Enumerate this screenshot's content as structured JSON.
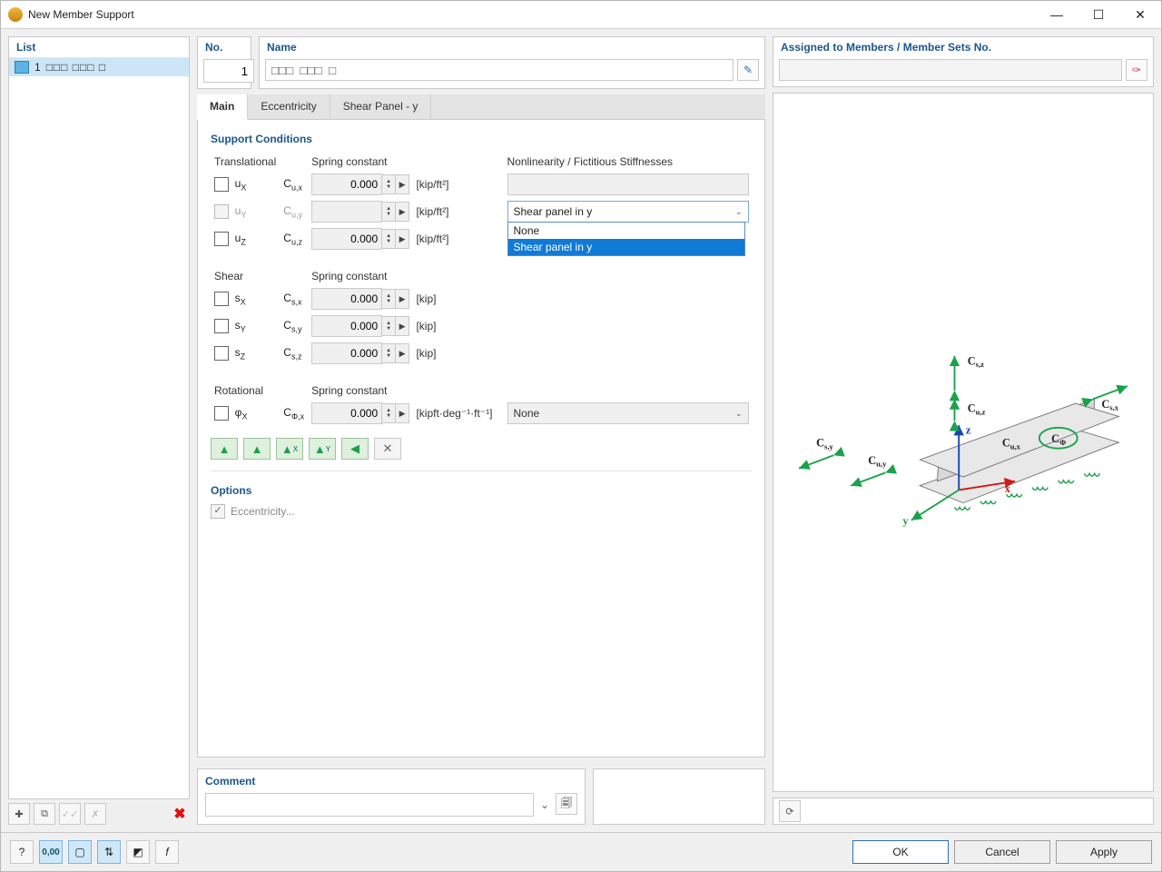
{
  "window": {
    "title": "New Member Support"
  },
  "left": {
    "header": "List",
    "row_index": "1",
    "row_text": "□□□  □□□  □"
  },
  "header": {
    "no_label": "No.",
    "no_value": "1",
    "name_label": "Name",
    "name_value": "□□□  □□□  □",
    "assigned_label": "Assigned to Members / Member Sets No."
  },
  "tabs": {
    "main": "Main",
    "ecc": "Eccentricity",
    "shear": "Shear Panel - y"
  },
  "support": {
    "title": "Support Conditions",
    "trans_label": "Translational",
    "spring_label": "Spring constant",
    "nonlin_label": "Nonlinearity / Fictitious Stiffnesses",
    "shear_label": "Shear",
    "rot_label": "Rotational",
    "rows": {
      "ux": {
        "sym": "u",
        "sub": "X",
        "k": "C",
        "ksub": "u,x",
        "val": "0.000",
        "unit": "[kip/ft²]"
      },
      "uy": {
        "sym": "u",
        "sub": "Y",
        "k": "C",
        "ksub": "u,y",
        "val": "",
        "unit": "[kip/ft²]"
      },
      "uz": {
        "sym": "u",
        "sub": "Z",
        "k": "C",
        "ksub": "u,z",
        "val": "0.000",
        "unit": "[kip/ft²]"
      },
      "sx": {
        "sym": "s",
        "sub": "X",
        "k": "C",
        "ksub": "s,x",
        "val": "0.000",
        "unit": "[kip]"
      },
      "sy": {
        "sym": "s",
        "sub": "Y",
        "k": "C",
        "ksub": "s,y",
        "val": "0.000",
        "unit": "[kip]"
      },
      "sz": {
        "sym": "s",
        "sub": "Z",
        "k": "C",
        "ksub": "s,z",
        "val": "0.000",
        "unit": "[kip]"
      },
      "phix": {
        "sym": "φ",
        "sub": "X",
        "k": "C",
        "ksub": "Φ,x",
        "val": "0.000",
        "unit": "[kipft·deg⁻¹·ft⁻¹]"
      }
    },
    "combo_uy": {
      "value": "Shear panel in y",
      "options": {
        "none": "None",
        "shear": "Shear panel in y"
      }
    },
    "combo_phix": {
      "value": "None"
    }
  },
  "options": {
    "title": "Options",
    "ecc": "Eccentricity..."
  },
  "comment": {
    "title": "Comment"
  },
  "footer": {
    "ok": "OK",
    "cancel": "Cancel",
    "apply": "Apply"
  },
  "preview_labels": {
    "csz": "C",
    "csz_sub": "s,z",
    "cuz": "C",
    "cuz_sub": "u,z",
    "csx": "C",
    "csx_sub": "s,x",
    "cux": "C",
    "cux_sub": "u,x",
    "csy": "C",
    "csy_sub": "s,y",
    "cuy": "C",
    "cuy_sub": "u,y",
    "cphi": "C",
    "cphi_sub": "Φ",
    "z": "z",
    "x": "x",
    "y": "y"
  }
}
